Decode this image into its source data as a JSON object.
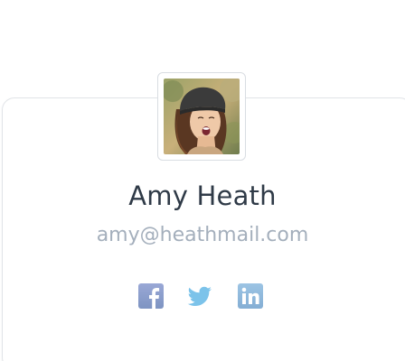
{
  "profile": {
    "name": "Amy Heath",
    "email": "amy@heathmail.com"
  },
  "socials": [
    {
      "network": "facebook",
      "icon": "facebook-icon",
      "color": "#8aa0c8"
    },
    {
      "network": "twitter",
      "icon": "twitter-icon",
      "color": "#7cc3ea"
    },
    {
      "network": "linkedin",
      "icon": "linkedin-icon",
      "color": "#8fb8da"
    }
  ]
}
